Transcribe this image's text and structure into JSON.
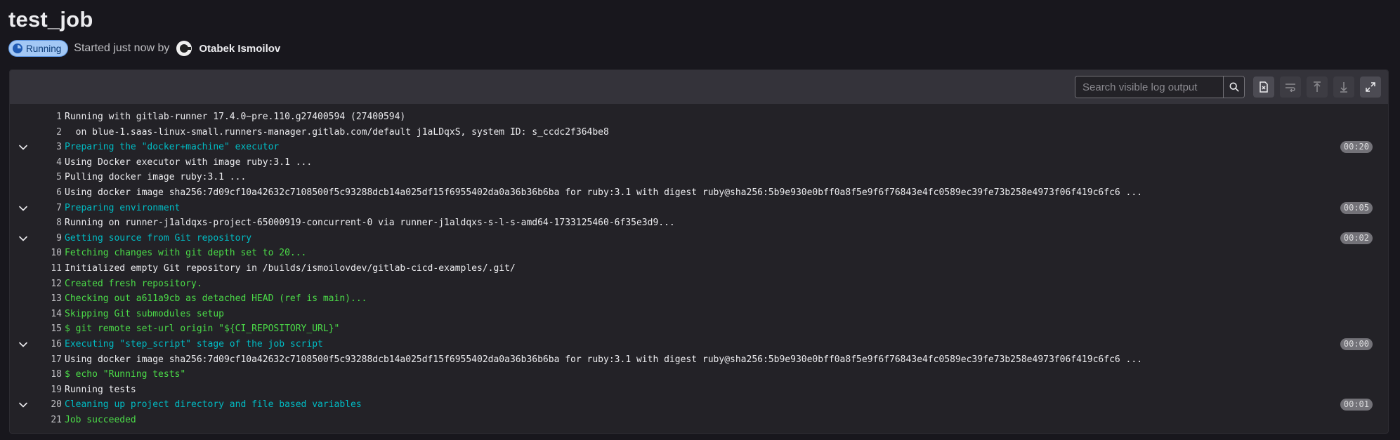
{
  "job": {
    "title": "test_job",
    "status": "Running",
    "started_text": "Started just now by",
    "user_name": "Otabek Ismoilov"
  },
  "toolbar": {
    "search_placeholder": "Search visible log output",
    "icons": [
      "search-icon",
      "raw-log-icon",
      "wrap-lines-icon",
      "scroll-to-top-icon",
      "scroll-to-bottom-icon",
      "fullscreen-icon"
    ]
  },
  "colors": {
    "background": "#18171d",
    "section_header": "#00bcc4",
    "success_text": "#4bdb48",
    "status_badge": "#a3c8f5"
  },
  "log_lines": [
    {
      "num": "1",
      "text": "Running with gitlab-runner 17.4.0~pre.110.g27400594 (27400594)",
      "color": "default",
      "section": false,
      "duration": ""
    },
    {
      "num": "2",
      "text": "  on blue-1.saas-linux-small.runners-manager.gitlab.com/default j1aLDqxS, system ID: s_ccdc2f364be8",
      "color": "default",
      "section": false,
      "duration": ""
    },
    {
      "num": "3",
      "text": "Preparing the \"docker+machine\" executor",
      "color": "section",
      "section": true,
      "duration": "00:20"
    },
    {
      "num": "4",
      "text": "Using Docker executor with image ruby:3.1 ...",
      "color": "default",
      "section": false,
      "duration": ""
    },
    {
      "num": "5",
      "text": "Pulling docker image ruby:3.1 ...",
      "color": "default",
      "section": false,
      "duration": ""
    },
    {
      "num": "6",
      "text": "Using docker image sha256:7d09cf10a42632c7108500f5c93288dcb14a025df15f6955402da0a36b36b6ba for ruby:3.1 with digest ruby@sha256:5b9e930e0bff0a8f5e9f6f76843e4fc0589ec39fe73b258e4973f06f419c6fc6 ...",
      "color": "default",
      "section": false,
      "duration": ""
    },
    {
      "num": "7",
      "text": "Preparing environment",
      "color": "section",
      "section": true,
      "duration": "00:05"
    },
    {
      "num": "8",
      "text": "Running on runner-j1aldqxs-project-65000919-concurrent-0 via runner-j1aldqxs-s-l-s-amd64-1733125460-6f35e3d9...",
      "color": "default",
      "section": false,
      "duration": ""
    },
    {
      "num": "9",
      "text": "Getting source from Git repository",
      "color": "section",
      "section": true,
      "duration": "00:02"
    },
    {
      "num": "10",
      "text": "Fetching changes with git depth set to 20...",
      "color": "green",
      "section": false,
      "duration": ""
    },
    {
      "num": "11",
      "text": "Initialized empty Git repository in /builds/ismoilovdev/gitlab-cicd-examples/.git/",
      "color": "default",
      "section": false,
      "duration": ""
    },
    {
      "num": "12",
      "text": "Created fresh repository.",
      "color": "green",
      "section": false,
      "duration": ""
    },
    {
      "num": "13",
      "text": "Checking out a611a9cb as detached HEAD (ref is main)...",
      "color": "green",
      "section": false,
      "duration": ""
    },
    {
      "num": "14",
      "text": "Skipping Git submodules setup",
      "color": "green",
      "section": false,
      "duration": ""
    },
    {
      "num": "15",
      "text": "$ git remote set-url origin \"${CI_REPOSITORY_URL}\"",
      "color": "green",
      "section": false,
      "duration": ""
    },
    {
      "num": "16",
      "text": "Executing \"step_script\" stage of the job script",
      "color": "section",
      "section": true,
      "duration": "00:00"
    },
    {
      "num": "17",
      "text": "Using docker image sha256:7d09cf10a42632c7108500f5c93288dcb14a025df15f6955402da0a36b36b6ba for ruby:3.1 with digest ruby@sha256:5b9e930e0bff0a8f5e9f6f76843e4fc0589ec39fe73b258e4973f06f419c6fc6 ...",
      "color": "default",
      "section": false,
      "duration": ""
    },
    {
      "num": "18",
      "text": "$ echo \"Running tests\"",
      "color": "green",
      "section": false,
      "duration": ""
    },
    {
      "num": "19",
      "text": "Running tests",
      "color": "default",
      "section": false,
      "duration": ""
    },
    {
      "num": "20",
      "text": "Cleaning up project directory and file based variables",
      "color": "section",
      "section": true,
      "duration": "00:01"
    },
    {
      "num": "21",
      "text": "Job succeeded",
      "color": "green",
      "section": false,
      "duration": ""
    }
  ]
}
